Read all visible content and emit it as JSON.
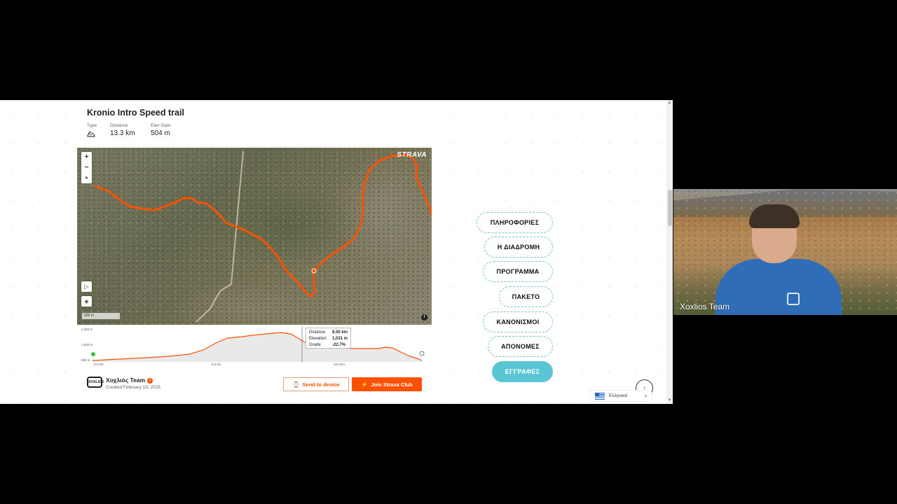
{
  "route": {
    "title": "Kronio Intro Speed trail",
    "type_label": "Type",
    "distance_label": "Distance",
    "distance_value": "13.3 km",
    "elev_label": "Elev Gain",
    "elev_value": "504 m"
  },
  "map": {
    "logo": "STRAVA",
    "zoom_in": "+",
    "zoom_out": "−",
    "compass": "▲",
    "play": "▷",
    "layers": "◈",
    "scale": "200 m",
    "info": "i"
  },
  "elevation": {
    "y_ticks": [
      "1,200 m",
      "1,000 m",
      "800 m"
    ],
    "x_ticks": [
      "0.0 km",
      "5.0 km",
      "10.0 km"
    ],
    "tooltip": {
      "distance_label": "Distance",
      "distance_value": "8.50 km",
      "elevation_label": "Elevation",
      "elevation_value": "1,031 m",
      "grade_label": "Grade",
      "grade_value": "-22.7%"
    }
  },
  "club": {
    "logo_text": "XOXLIOS",
    "name": "Χοχλιός Team",
    "created": "Created February 19, 2025"
  },
  "actions": {
    "send_label": "Send to device",
    "join_label": "Join Strava Club"
  },
  "nav": [
    {
      "label": "ΠΛΗΡΟΦΟΡΙΕΣ"
    },
    {
      "label": "Η ΔΙΑΔΡΟΜΗ"
    },
    {
      "label": "ΠΡΟΓΡΑΜΜΑ"
    },
    {
      "label": "ΠΑΚΕΤΟ"
    },
    {
      "label": "ΚΑΝΟΝΙΣΜΟΙ"
    },
    {
      "label": "ΑΠΟΝΟΜΕΣ"
    },
    {
      "label": "ΕΓΓΡΑΦΕΣ"
    }
  ],
  "language": {
    "label": "Ελληνικά"
  },
  "webcam": {
    "name": "Xoxlios Team"
  },
  "colors": {
    "strava_orange": "#fc5200",
    "nav_accent": "#5bc6d3"
  }
}
